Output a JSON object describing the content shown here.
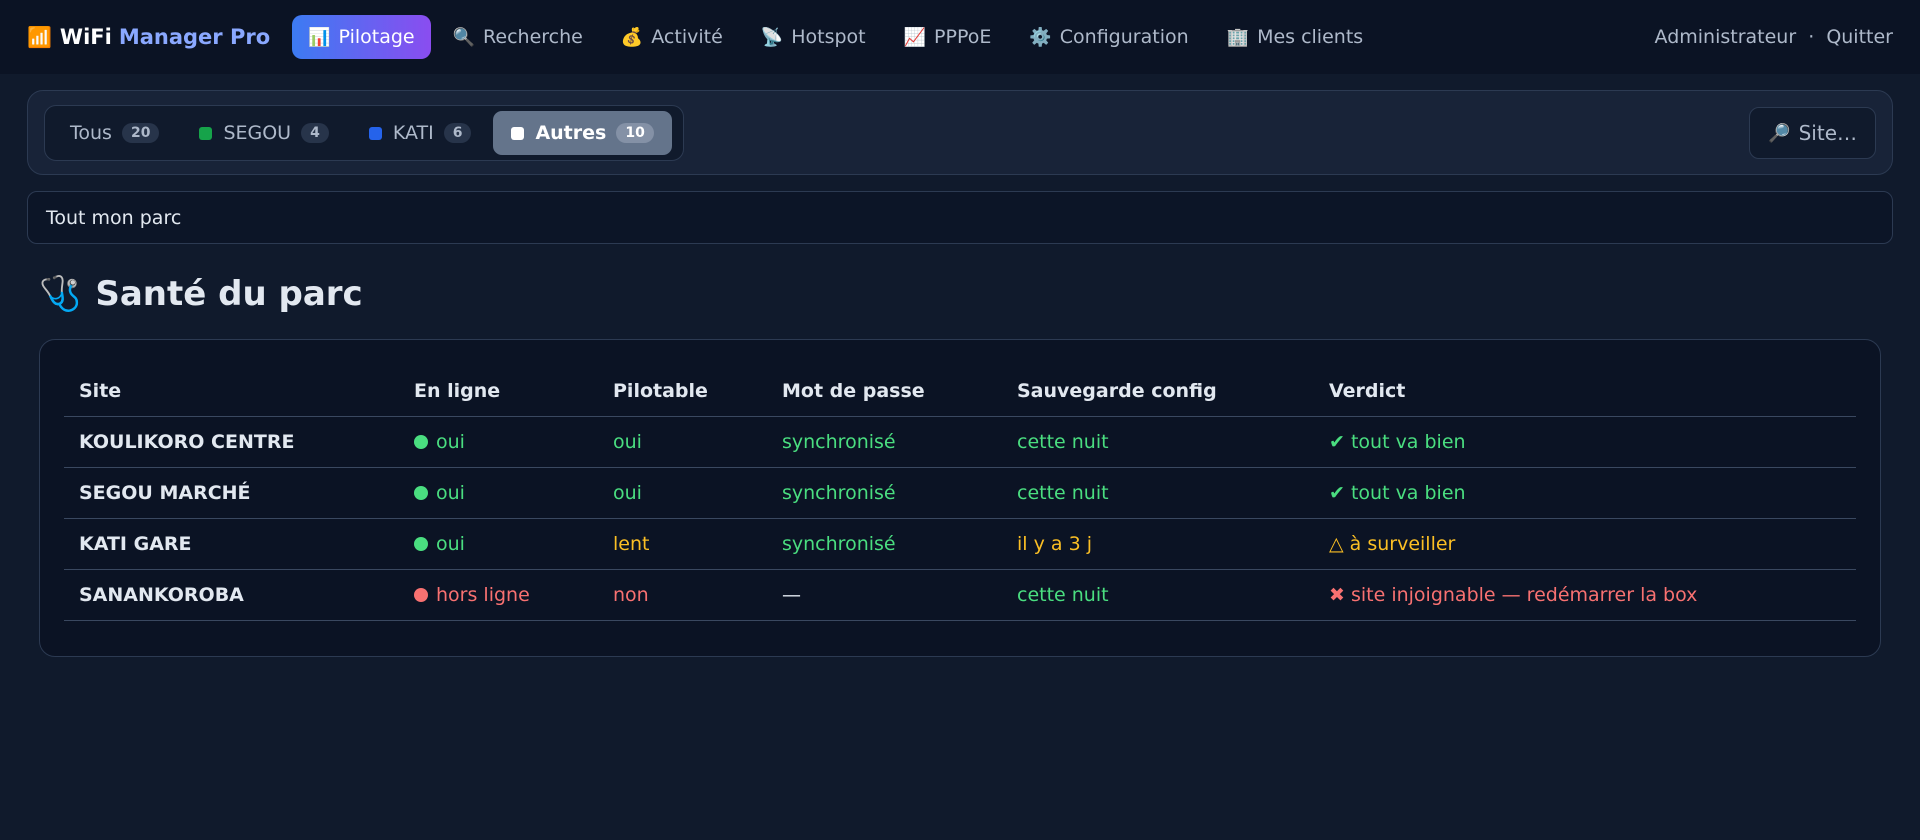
{
  "app": {
    "brand_icon": "📶",
    "brand_name": "WiFi",
    "brand_accent": "Manager Pro"
  },
  "nav": {
    "items": [
      {
        "icon": "📊",
        "label": "Pilotage",
        "active": true
      },
      {
        "icon": "🔍",
        "label": "Recherche"
      },
      {
        "icon": "💰",
        "label": "Activité"
      },
      {
        "icon": "📡",
        "label": "Hotspot"
      },
      {
        "icon": "📈",
        "label": "PPPoE"
      },
      {
        "icon": "⚙️",
        "label": "Configuration"
      },
      {
        "icon": "🏢",
        "label": "Mes clients"
      }
    ],
    "user": "Administrateur",
    "separator": "·",
    "logout": "Quitter"
  },
  "filters": {
    "segments": [
      {
        "label": "Tous",
        "count": "20"
      },
      {
        "label": "SEGOU",
        "count": "4",
        "color": "#16a34a"
      },
      {
        "label": "KATI",
        "count": "6",
        "color": "#2563eb"
      },
      {
        "label": "Autres",
        "count": "10",
        "color": "#ffffff",
        "active": true
      }
    ],
    "site_button_icon": "🔎",
    "site_button": "Site…"
  },
  "scope": {
    "selected": "Tout mon parc"
  },
  "health": {
    "icon": "🩺",
    "title": "Santé du parc",
    "columns": [
      "Site",
      "En ligne",
      "Pilotable",
      "Mot de passe",
      "Sauvegarde config",
      "Verdict"
    ],
    "rows": [
      {
        "site": "KOULIKORO CENTRE",
        "online": "oui",
        "online_state": "ok",
        "pilotable": "oui",
        "pilotable_state": "ok",
        "password": "synchronisé",
        "password_state": "ok",
        "backup": "cette nuit",
        "backup_state": "ok",
        "verdict": "✔ tout va bien",
        "verdict_state": "ok"
      },
      {
        "site": "SEGOU MARCHÉ",
        "online": "oui",
        "online_state": "ok",
        "pilotable": "oui",
        "pilotable_state": "ok",
        "password": "synchronisé",
        "password_state": "ok",
        "backup": "cette nuit",
        "backup_state": "ok",
        "verdict": "✔ tout va bien",
        "verdict_state": "ok"
      },
      {
        "site": "KATI GARE",
        "online": "oui",
        "online_state": "ok",
        "pilotable": "lent",
        "pilotable_state": "warn",
        "password": "synchronisé",
        "password_state": "ok",
        "backup": "il y a 3 j",
        "backup_state": "warn",
        "verdict": "△ à surveiller",
        "verdict_state": "warn"
      },
      {
        "site": "SANANKOROBA",
        "online": "hors ligne",
        "online_state": "bad",
        "pilotable": "non",
        "pilotable_state": "bad",
        "password": "—",
        "password_state": "muted",
        "backup": "cette nuit",
        "backup_state": "ok",
        "verdict": "✖ site injoignable — redémarrer la box",
        "verdict_state": "bad"
      }
    ]
  }
}
